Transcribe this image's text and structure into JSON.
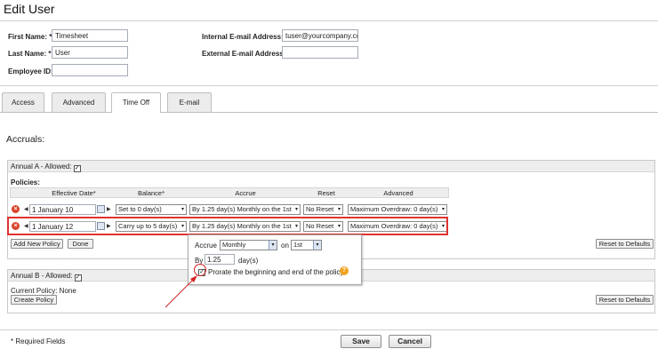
{
  "page": {
    "title": "Edit User"
  },
  "user_form": {
    "first_name_label": "First Name: *",
    "first_name_value": "Timesheet",
    "last_name_label": "Last Name: *",
    "last_name_value": "User",
    "employee_id_label": "Employee ID:",
    "employee_id_value": "",
    "internal_email_label": "Internal E-mail Address:",
    "internal_email_value": "tuser@yourcompany.cc",
    "external_email_label": "External E-mail Address:",
    "external_email_value": ""
  },
  "tabs": [
    {
      "label": "Access"
    },
    {
      "label": "Advanced"
    },
    {
      "label": "Time Off",
      "active": true
    },
    {
      "label": "E-mail"
    }
  ],
  "accruals": {
    "heading": "Accruals:",
    "annual_a": {
      "title": "Annual A - Allowed:",
      "policies_label": "Policies:",
      "columns": [
        "Effective Date*",
        "Balance*",
        "Accrue",
        "Reset",
        "Advanced"
      ],
      "rows": [
        {
          "date": "1 January 10",
          "balance": "Set to 0 day(s)",
          "accrue": "By 1.25 day(s) Monthly on the 1st",
          "reset": "No Reset",
          "advanced": "Maximum Overdraw: 0 day(s)"
        },
        {
          "date": "1 January 12",
          "balance": "Carry up to 5 day(s)",
          "accrue": "By 1.25 day(s) Monthly on the 1st",
          "reset": "No Reset",
          "advanced": "Maximum Overdraw: 0 day(s)"
        }
      ],
      "add_policy_label": "Add New Policy",
      "done_label": "Done",
      "reset_defaults_label": "Reset to Defaults"
    },
    "accrue_popup": {
      "accrue_label": "Accrue",
      "frequency": "Monthly",
      "on_label": "on",
      "day": "1st",
      "by_label": "By",
      "amount": "1.25",
      "unit_label": "day(s)",
      "prorate_label": "Prorate the beginning and end of the policy",
      "help_glyph": "?"
    },
    "annual_b": {
      "title": "Annual B - Allowed:",
      "current_policy_label": "Current Policy: None",
      "create_policy_label": "Create Policy",
      "reset_defaults_label": "Reset to Defaults"
    }
  },
  "footer": {
    "required_note": "* Required Fields",
    "save_label": "Save",
    "cancel_label": "Cancel"
  },
  "glyphs": {
    "check": "✓",
    "dropdown": "▾",
    "left": "◀",
    "right": "▶",
    "remove": "×"
  },
  "colors": {
    "highlight": "#e03232",
    "section_header": "#eeeeee",
    "help": "#f0a320"
  }
}
